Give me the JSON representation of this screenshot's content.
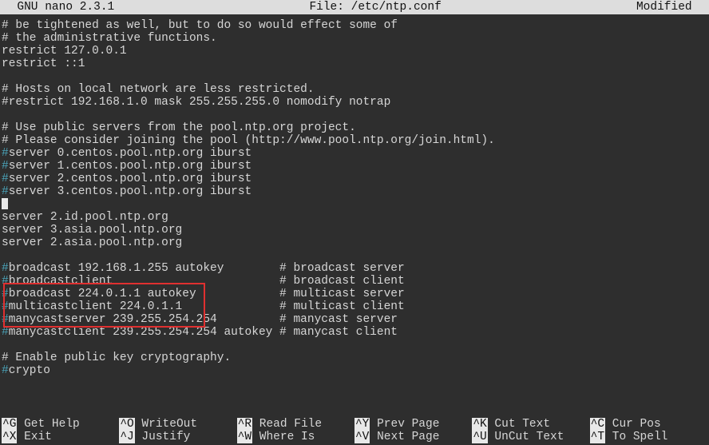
{
  "title": {
    "left": "  GNU nano 2.3.1",
    "center": "File: /etc/ntp.conf",
    "right": "Modified  "
  },
  "lines": [
    {
      "t": "# be tightened as well, but to do so would effect some of"
    },
    {
      "t": "# the administrative functions."
    },
    {
      "t": "restrict 127.0.0.1"
    },
    {
      "t": "restrict ::1"
    },
    {
      "t": ""
    },
    {
      "t": "# Hosts on local network are less restricted."
    },
    {
      "t": "#restrict 192.168.1.0 mask 255.255.255.0 nomodify notrap"
    },
    {
      "t": ""
    },
    {
      "t": "# Use public servers from the pool.ntp.org project."
    },
    {
      "t": "# Please consider joining the pool (http://www.pool.ntp.org/join.html)."
    },
    {
      "h": "#",
      "t": "server 0.centos.pool.ntp.org iburst"
    },
    {
      "h": "#",
      "t": "server 1.centos.pool.ntp.org iburst"
    },
    {
      "h": "#",
      "t": "server 2.centos.pool.ntp.org iburst"
    },
    {
      "h": "#",
      "t": "server 3.centos.pool.ntp.org iburst"
    },
    {
      "cursor": true
    },
    {
      "t": "server 2.id.pool.ntp.org"
    },
    {
      "t": "server 3.asia.pool.ntp.org"
    },
    {
      "t": "server 2.asia.pool.ntp.org"
    },
    {
      "t": ""
    },
    {
      "h": "#",
      "t": "broadcast 192.168.1.255 autokey        # broadcast server"
    },
    {
      "h": "#",
      "t": "broadcastclient                        # broadcast client"
    },
    {
      "h": "#",
      "t": "broadcast 224.0.1.1 autokey            # multicast server"
    },
    {
      "h": "#",
      "t": "multicastclient 224.0.1.1              # multicast client"
    },
    {
      "h": "#",
      "t": "manycastserver 239.255.254.254         # manycast server"
    },
    {
      "h": "#",
      "t": "manycastclient 239.255.254.254 autokey # manycast client"
    },
    {
      "t": ""
    },
    {
      "t": "# Enable public key cryptography."
    },
    {
      "h": "#",
      "t": "crypto"
    }
  ],
  "hotkeys": {
    "row1": [
      {
        "k": "^G",
        "l": " Get Help"
      },
      {
        "k": "^O",
        "l": " WriteOut"
      },
      {
        "k": "^R",
        "l": " Read File"
      },
      {
        "k": "^Y",
        "l": " Prev Page"
      },
      {
        "k": "^K",
        "l": " Cut Text"
      },
      {
        "k": "^C",
        "l": " Cur Pos"
      }
    ],
    "row2": [
      {
        "k": "^X",
        "l": " Exit"
      },
      {
        "k": "^J",
        "l": " Justify"
      },
      {
        "k": "^W",
        "l": " Where Is"
      },
      {
        "k": "^V",
        "l": " Next Page"
      },
      {
        "k": "^U",
        "l": " UnCut Text"
      },
      {
        "k": "^T",
        "l": " To Spell"
      }
    ]
  }
}
